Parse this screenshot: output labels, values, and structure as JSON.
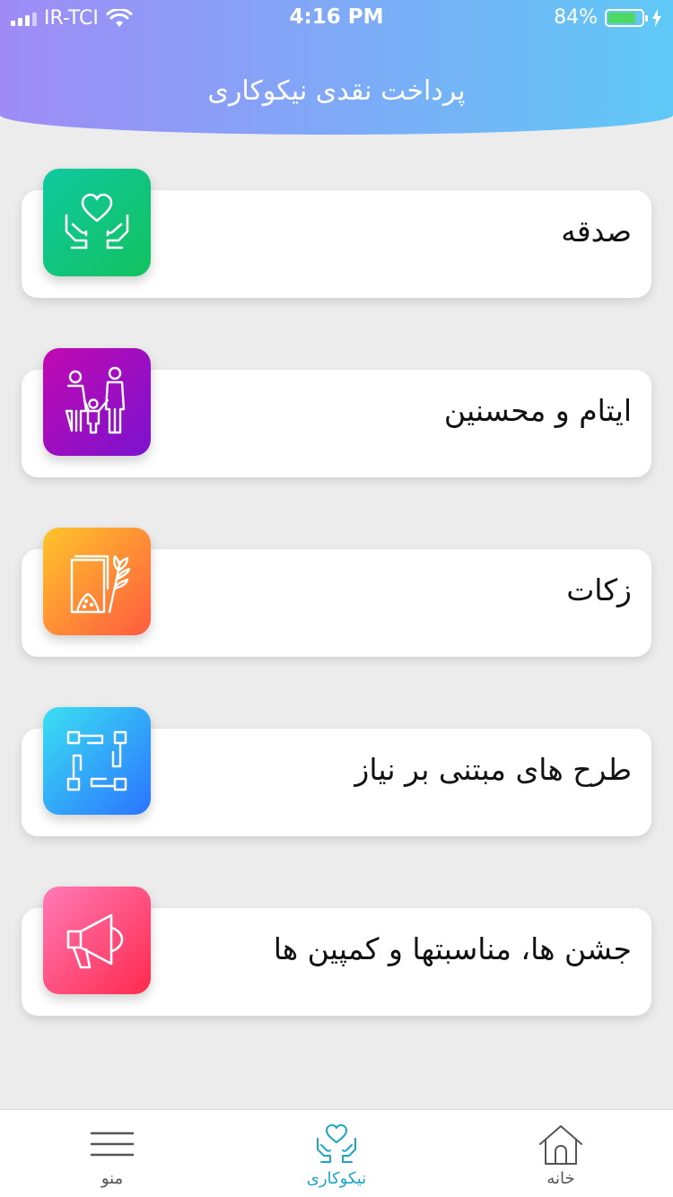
{
  "status_bar": {
    "carrier": "IR-TCI",
    "time": "4:16 PM",
    "battery_percent": "84%",
    "battery_level": 0.84
  },
  "header": {
    "title": "پرداخت نقدی نیکوکاری"
  },
  "cards": [
    {
      "label": "صدقه",
      "icon": "charity-hands-heart-icon"
    },
    {
      "label": "ایتام و محسنین",
      "icon": "family-icon"
    },
    {
      "label": "زکات",
      "icon": "wheat-grain-icon"
    },
    {
      "label": "طرح های مبتنی بر نیاز",
      "icon": "teamwork-hands-icon"
    },
    {
      "label": "جشن ها، مناسبتها و کمپین ها",
      "icon": "megaphone-icon"
    }
  ],
  "bottom_nav": {
    "menu": {
      "label": "منو",
      "icon": "hamburger-menu-icon"
    },
    "charity": {
      "label": "نیکوکاری",
      "icon": "hands-heart-icon",
      "active": true
    },
    "home": {
      "label": "خانه",
      "icon": "home-icon"
    }
  },
  "colors": {
    "header_gradient": [
      "#9f8bf6",
      "#5fc9f6"
    ],
    "active_nav": "#1aa7c7",
    "background": "#ececec"
  }
}
